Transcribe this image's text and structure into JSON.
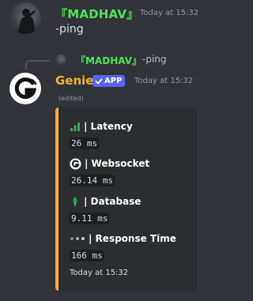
{
  "message1": {
    "username": "『MADHAV』",
    "timestamp": "Today at 15:32",
    "content": "-ping",
    "avatar": "user-avatar"
  },
  "reply": {
    "username": "『MADHAV』",
    "content": "-ping"
  },
  "bot_message": {
    "username": "Genie",
    "badge": "APP",
    "timestamp": "Today at 15:32",
    "edited": "(edited)",
    "name_color": "#f0b232",
    "avatar": "genie-logo"
  },
  "embed": {
    "accent_color": "#f0b232",
    "fields": [
      {
        "icon": "signal-bars-icon",
        "title": "| Latency",
        "value": "26 ms"
      },
      {
        "icon": "genie-logo-icon",
        "title": "| Websocket",
        "value": "26.14 ms"
      },
      {
        "icon": "mongodb-leaf-icon",
        "title": "| Database",
        "value": "9.11 ms"
      },
      {
        "icon": "loading-dots-icon",
        "title": "| Response Time",
        "value": "166 ms"
      }
    ],
    "footer": "Today at 15:32"
  },
  "colors": {
    "background": "#313338",
    "embed_background": "#2b2d31",
    "username_green": "#4ee35a",
    "badge_blurple": "#5865f2"
  }
}
